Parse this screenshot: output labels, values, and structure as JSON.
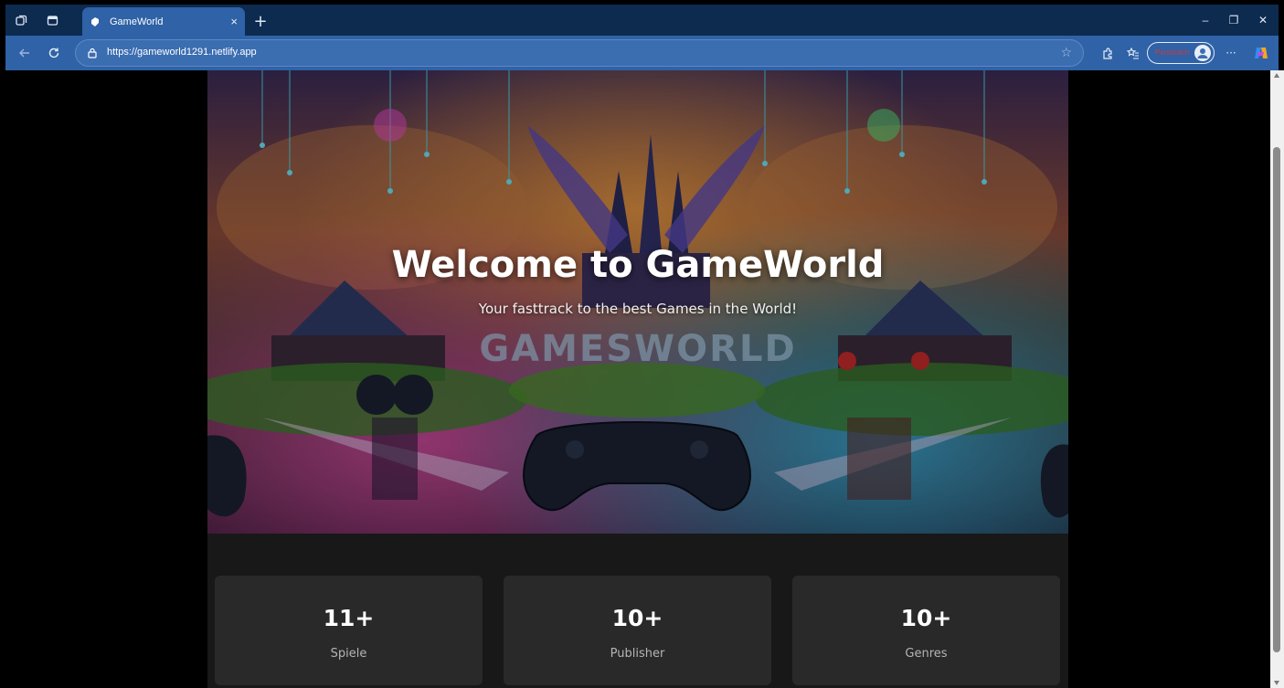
{
  "browser": {
    "tab_title": "GameWorld",
    "tab_close": "×",
    "new_tab": "+",
    "url": "https://gameworld1291.netlify.app",
    "profile_label": "Persönlich",
    "more_label": "···",
    "window_controls": {
      "minimize": "–",
      "restore": "❐",
      "close": "✕"
    }
  },
  "hero": {
    "title": "Welcome to GameWorld",
    "subtitle": "Your fasttrack to the best Games in the World!",
    "image_text": "GAMESWORLD"
  },
  "stats": [
    {
      "value": "11+",
      "label": "Spiele"
    },
    {
      "value": "10+",
      "label": "Publisher"
    },
    {
      "value": "10+",
      "label": "Genres"
    }
  ],
  "colors": {
    "titlebar": "#0d2a4f",
    "toolbar": "#2f62a6",
    "page_bg": "#181818",
    "card_bg": "#292929"
  }
}
